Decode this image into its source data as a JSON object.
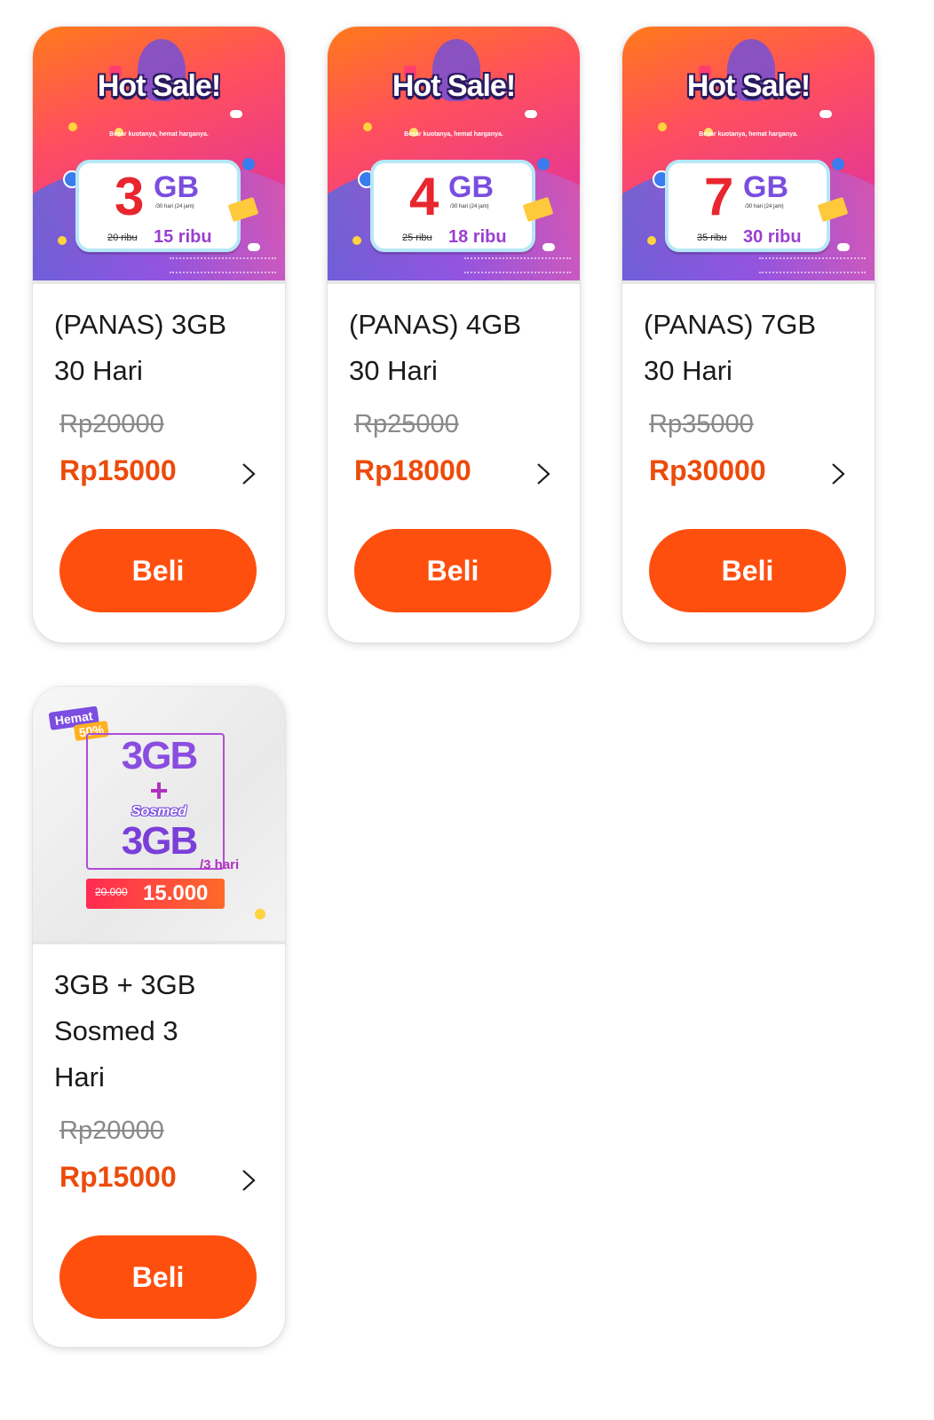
{
  "products": [
    {
      "banner": {
        "style": "hot-sale",
        "headline": "Hot Sale!",
        "tagline": "Besar kuotanya, hemat harganya.",
        "quota_number": "3",
        "quota_unit": "GB",
        "period": "/30 hari (24 jam)",
        "old_price": "20 ribu",
        "new_price": "15 ribu"
      },
      "title": "(PANAS) 3GB 30 Hari",
      "old_price": "Rp20000",
      "price": "Rp15000",
      "buy_label": "Beli"
    },
    {
      "banner": {
        "style": "hot-sale",
        "headline": "Hot Sale!",
        "tagline": "Besar kuotanya, hemat harganya.",
        "quota_number": "4",
        "quota_unit": "GB",
        "period": "/30 hari (24 jam)",
        "old_price": "25 ribu",
        "new_price": "18 ribu"
      },
      "title": "(PANAS) 4GB 30 Hari",
      "old_price": "Rp25000",
      "price": "Rp18000",
      "buy_label": "Beli"
    },
    {
      "banner": {
        "style": "hot-sale",
        "headline": "Hot Sale!",
        "tagline": "Besar kuotanya, hemat harganya.",
        "quota_number": "7",
        "quota_unit": "GB",
        "period": "/30 hari (24 jam)",
        "old_price": "35 ribu",
        "new_price": "30 ribu"
      },
      "title": "(PANAS) 7GB 30 Hari",
      "old_price": "Rp35000",
      "price": "Rp30000",
      "buy_label": "Beli"
    },
    {
      "banner": {
        "style": "sosmed",
        "badge_top": "Hemat",
        "badge_bottom": "50%",
        "line1": "3GB",
        "plus": "+",
        "sosmed": "Sosmed",
        "line2": "3GB",
        "period": "/3 hari",
        "old_price": "20.000",
        "new_price": "15.000"
      },
      "title": "3GB + 3GB Sosmed 3 Hari",
      "old_price": "Rp20000",
      "price": "Rp15000",
      "buy_label": "Beli"
    }
  ],
  "colors": {
    "accent": "#ff4f0f",
    "price": "#ec4b0b",
    "old_price": "#8a8a8a",
    "text": "#1a1a1a"
  },
  "icons": {
    "detail_chevron": "chevron-right-icon"
  }
}
